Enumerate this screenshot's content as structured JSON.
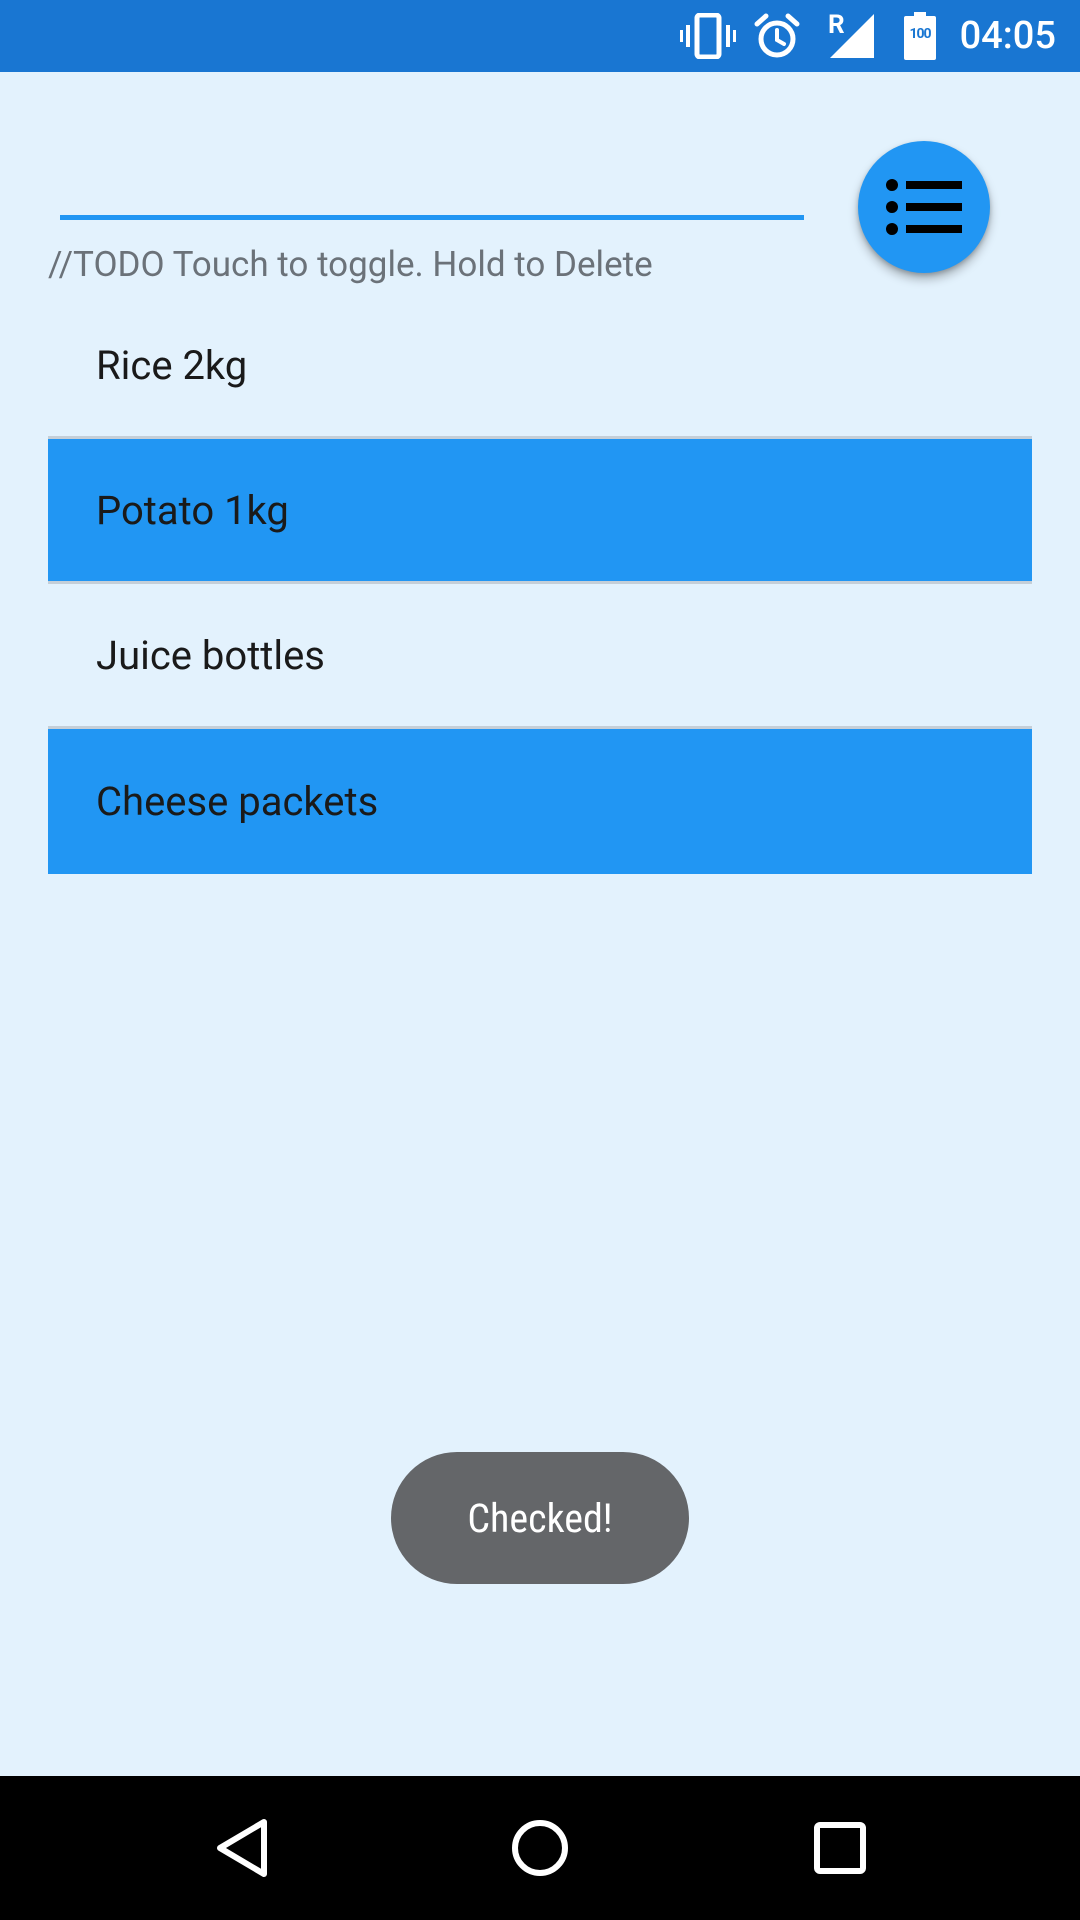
{
  "status_bar": {
    "time": "04:05",
    "network_label": "R",
    "battery_level": "100",
    "icons": [
      "vibrate-icon",
      "alarm-icon",
      "signal-icon",
      "battery-icon"
    ],
    "background": "#1976d2"
  },
  "input": {
    "value": "",
    "placeholder": ""
  },
  "fab": {
    "icon": "list-icon",
    "color": "#2196f3"
  },
  "hint": "//TODO Touch to toggle. Hold to Delete",
  "items": [
    {
      "label": "Rice 2kg",
      "checked": false
    },
    {
      "label": "Potato 1kg",
      "checked": true
    },
    {
      "label": "Juice bottles",
      "checked": false
    },
    {
      "label": "Cheese packets",
      "checked": true
    }
  ],
  "toast": "Checked!",
  "nav_bar": {
    "buttons": [
      "back-icon",
      "home-icon",
      "recents-icon"
    ]
  },
  "colors": {
    "accent": "#2196f3",
    "background": "#e3f2fd",
    "checked_row": "#2196f3"
  }
}
